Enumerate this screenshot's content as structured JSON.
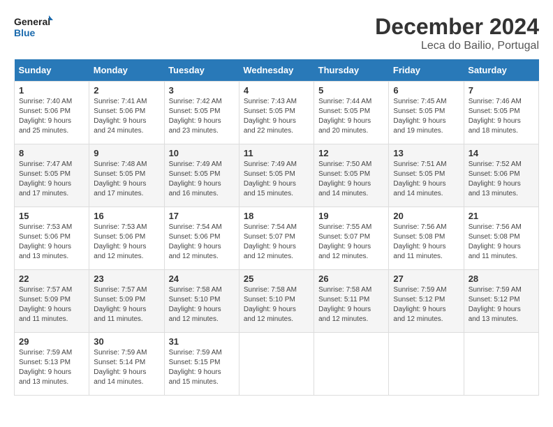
{
  "header": {
    "logo_line1": "General",
    "logo_line2": "Blue",
    "month": "December 2024",
    "location": "Leca do Bailio, Portugal"
  },
  "weekdays": [
    "Sunday",
    "Monday",
    "Tuesday",
    "Wednesday",
    "Thursday",
    "Friday",
    "Saturday"
  ],
  "weeks": [
    [
      {
        "day": "1",
        "sunrise": "7:40 AM",
        "sunset": "5:06 PM",
        "daylight": "9 hours and 25 minutes."
      },
      {
        "day": "2",
        "sunrise": "7:41 AM",
        "sunset": "5:06 PM",
        "daylight": "9 hours and 24 minutes."
      },
      {
        "day": "3",
        "sunrise": "7:42 AM",
        "sunset": "5:05 PM",
        "daylight": "9 hours and 23 minutes."
      },
      {
        "day": "4",
        "sunrise": "7:43 AM",
        "sunset": "5:05 PM",
        "daylight": "9 hours and 22 minutes."
      },
      {
        "day": "5",
        "sunrise": "7:44 AM",
        "sunset": "5:05 PM",
        "daylight": "9 hours and 20 minutes."
      },
      {
        "day": "6",
        "sunrise": "7:45 AM",
        "sunset": "5:05 PM",
        "daylight": "9 hours and 19 minutes."
      },
      {
        "day": "7",
        "sunrise": "7:46 AM",
        "sunset": "5:05 PM",
        "daylight": "9 hours and 18 minutes."
      }
    ],
    [
      {
        "day": "8",
        "sunrise": "7:47 AM",
        "sunset": "5:05 PM",
        "daylight": "9 hours and 17 minutes."
      },
      {
        "day": "9",
        "sunrise": "7:48 AM",
        "sunset": "5:05 PM",
        "daylight": "9 hours and 17 minutes."
      },
      {
        "day": "10",
        "sunrise": "7:49 AM",
        "sunset": "5:05 PM",
        "daylight": "9 hours and 16 minutes."
      },
      {
        "day": "11",
        "sunrise": "7:49 AM",
        "sunset": "5:05 PM",
        "daylight": "9 hours and 15 minutes."
      },
      {
        "day": "12",
        "sunrise": "7:50 AM",
        "sunset": "5:05 PM",
        "daylight": "9 hours and 14 minutes."
      },
      {
        "day": "13",
        "sunrise": "7:51 AM",
        "sunset": "5:05 PM",
        "daylight": "9 hours and 14 minutes."
      },
      {
        "day": "14",
        "sunrise": "7:52 AM",
        "sunset": "5:06 PM",
        "daylight": "9 hours and 13 minutes."
      }
    ],
    [
      {
        "day": "15",
        "sunrise": "7:53 AM",
        "sunset": "5:06 PM",
        "daylight": "9 hours and 13 minutes."
      },
      {
        "day": "16",
        "sunrise": "7:53 AM",
        "sunset": "5:06 PM",
        "daylight": "9 hours and 12 minutes."
      },
      {
        "day": "17",
        "sunrise": "7:54 AM",
        "sunset": "5:06 PM",
        "daylight": "9 hours and 12 minutes."
      },
      {
        "day": "18",
        "sunrise": "7:54 AM",
        "sunset": "5:07 PM",
        "daylight": "9 hours and 12 minutes."
      },
      {
        "day": "19",
        "sunrise": "7:55 AM",
        "sunset": "5:07 PM",
        "daylight": "9 hours and 12 minutes."
      },
      {
        "day": "20",
        "sunrise": "7:56 AM",
        "sunset": "5:08 PM",
        "daylight": "9 hours and 11 minutes."
      },
      {
        "day": "21",
        "sunrise": "7:56 AM",
        "sunset": "5:08 PM",
        "daylight": "9 hours and 11 minutes."
      }
    ],
    [
      {
        "day": "22",
        "sunrise": "7:57 AM",
        "sunset": "5:09 PM",
        "daylight": "9 hours and 11 minutes."
      },
      {
        "day": "23",
        "sunrise": "7:57 AM",
        "sunset": "5:09 PM",
        "daylight": "9 hours and 11 minutes."
      },
      {
        "day": "24",
        "sunrise": "7:58 AM",
        "sunset": "5:10 PM",
        "daylight": "9 hours and 12 minutes."
      },
      {
        "day": "25",
        "sunrise": "7:58 AM",
        "sunset": "5:10 PM",
        "daylight": "9 hours and 12 minutes."
      },
      {
        "day": "26",
        "sunrise": "7:58 AM",
        "sunset": "5:11 PM",
        "daylight": "9 hours and 12 minutes."
      },
      {
        "day": "27",
        "sunrise": "7:59 AM",
        "sunset": "5:12 PM",
        "daylight": "9 hours and 12 minutes."
      },
      {
        "day": "28",
        "sunrise": "7:59 AM",
        "sunset": "5:12 PM",
        "daylight": "9 hours and 13 minutes."
      }
    ],
    [
      {
        "day": "29",
        "sunrise": "7:59 AM",
        "sunset": "5:13 PM",
        "daylight": "9 hours and 13 minutes."
      },
      {
        "day": "30",
        "sunrise": "7:59 AM",
        "sunset": "5:14 PM",
        "daylight": "9 hours and 14 minutes."
      },
      {
        "day": "31",
        "sunrise": "7:59 AM",
        "sunset": "5:15 PM",
        "daylight": "9 hours and 15 minutes."
      },
      null,
      null,
      null,
      null
    ]
  ]
}
